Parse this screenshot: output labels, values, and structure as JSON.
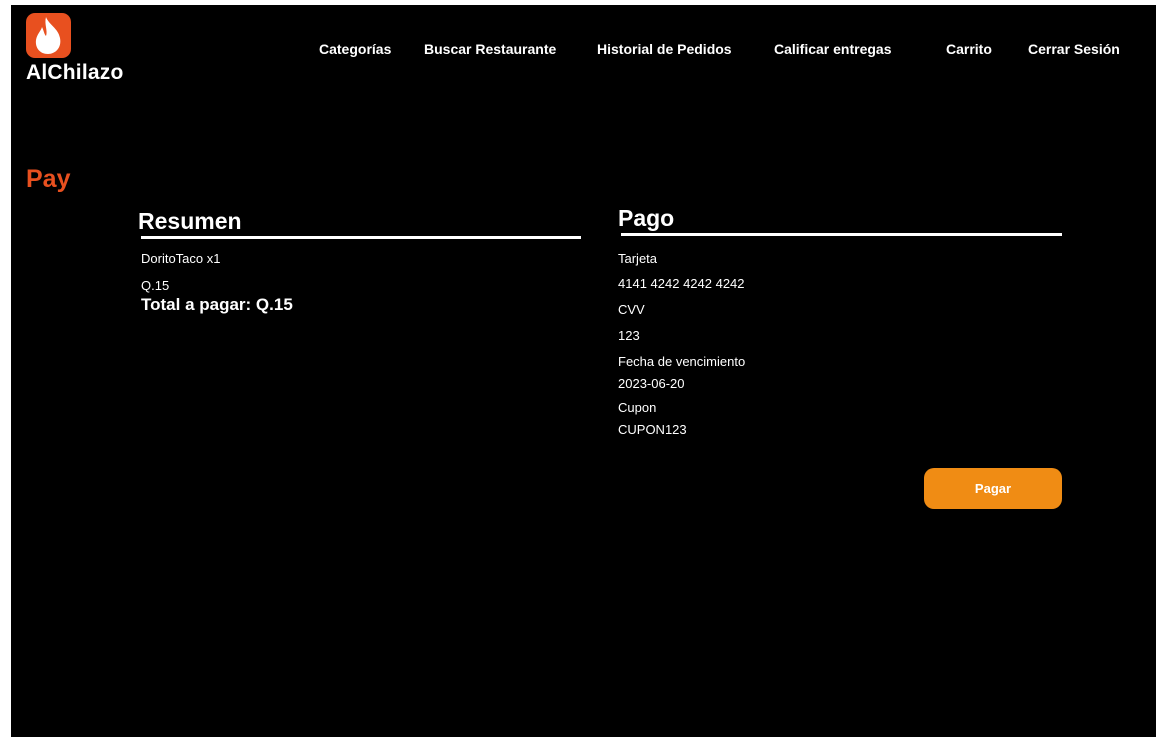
{
  "brand": {
    "name": "AlChilazo",
    "accent": "#e8501f"
  },
  "nav": {
    "items": [
      {
        "label": "Categorías"
      },
      {
        "label": "Buscar Restaurante"
      },
      {
        "label": "Historial de Pedidos"
      },
      {
        "label": "Calificar entregas"
      },
      {
        "label": "Carrito"
      },
      {
        "label": "Cerrar Sesión"
      }
    ]
  },
  "page": {
    "title": "Pay"
  },
  "summary": {
    "title": "Resumen",
    "item": "DoritoTaco x1",
    "price": "Q.15",
    "total": "Total a pagar: Q.15"
  },
  "payment": {
    "title": "Pago",
    "card_label": "Tarjeta",
    "card_value": "4141 4242 4242 4242",
    "cvv_label": "CVV",
    "cvv_value": "123",
    "expiry_label": "Fecha de vencimiento",
    "expiry_value": "2023-06-20",
    "coupon_label": "Cupon",
    "coupon_value": "CUPON123",
    "button_label": "Pagar",
    "button_color": "#f08c14"
  }
}
